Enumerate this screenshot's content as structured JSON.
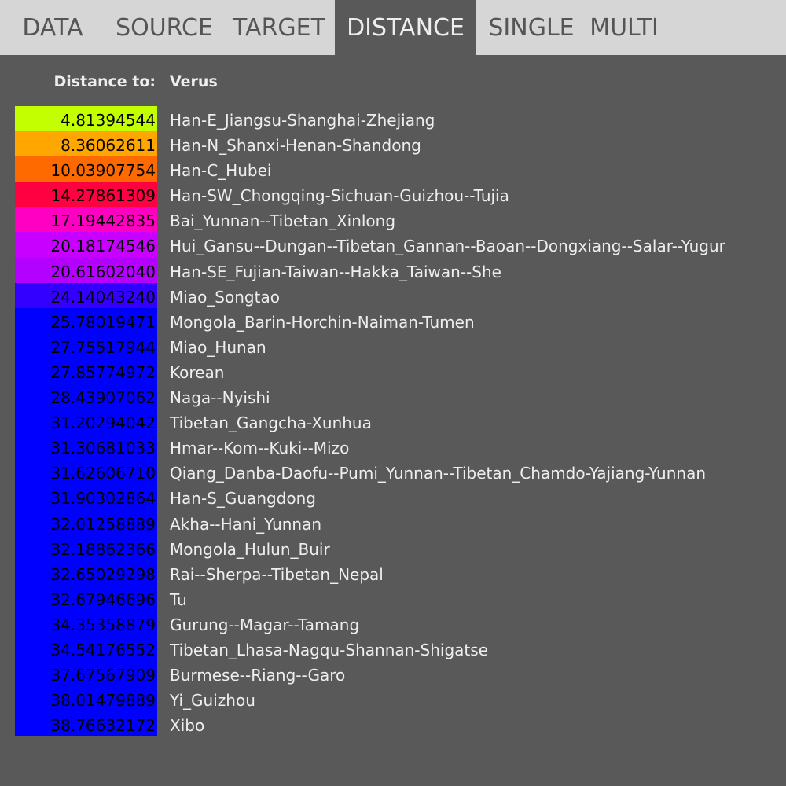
{
  "tabs": [
    {
      "label": "DATA",
      "active": false,
      "width": 134
    },
    {
      "label": "SOURCE",
      "active": false,
      "width": 150
    },
    {
      "label": "TARGET",
      "active": false,
      "width": 142
    },
    {
      "label": "DISTANCE",
      "active": true,
      "width": 180
    },
    {
      "label": "SINGLE",
      "active": false,
      "width": 140
    },
    {
      "label": "MULTI",
      "active": false,
      "width": 96
    }
  ],
  "header": {
    "distance_label": "Distance to:",
    "target_name": "Verus"
  },
  "results": [
    {
      "distance": "4.81394544",
      "name": "Han-E_Jiangsu-Shanghai-Zhejiang",
      "color": "#c3ff00"
    },
    {
      "distance": "8.36062611",
      "name": "Han-N_Shanxi-Henan-Shandong",
      "color": "#ffa700"
    },
    {
      "distance": "10.03907754",
      "name": "Han-C_Hubei",
      "color": "#ff6a00"
    },
    {
      "distance": "14.27861309",
      "name": "Han-SW_Chongqing-Sichuan-Guizhou--Tujia",
      "color": "#ff0040"
    },
    {
      "distance": "17.19442835",
      "name": "Bai_Yunnan--Tibetan_Xinlong",
      "color": "#ff00c3"
    },
    {
      "distance": "20.18174546",
      "name": "Hui_Gansu--Dungan--Tibetan_Gannan--Baoan--Dongxiang--Salar--Yugur",
      "color": "#c800ff"
    },
    {
      "distance": "20.61602040",
      "name": "Han-SE_Fujian-Taiwan--Hakka_Taiwan--She",
      "color": "#b400ff"
    },
    {
      "distance": "24.14043240",
      "name": "Miao_Songtao",
      "color": "#3300ff"
    },
    {
      "distance": "25.78019471",
      "name": "Mongola_Barin-Horchin-Naiman-Tumen",
      "color": "#0000ff"
    },
    {
      "distance": "27.75517944",
      "name": "Miao_Hunan",
      "color": "#0000ff"
    },
    {
      "distance": "27.85774972",
      "name": "Korean",
      "color": "#0000ff"
    },
    {
      "distance": "28.43907062",
      "name": "Naga--Nyishi",
      "color": "#0000ff"
    },
    {
      "distance": "31.20294042",
      "name": "Tibetan_Gangcha-Xunhua",
      "color": "#0000ff"
    },
    {
      "distance": "31.30681033",
      "name": "Hmar--Kom--Kuki--Mizo",
      "color": "#0000ff"
    },
    {
      "distance": "31.62606710",
      "name": "Qiang_Danba-Daofu--Pumi_Yunnan--Tibetan_Chamdo-Yajiang-Yunnan",
      "color": "#0000ff"
    },
    {
      "distance": "31.90302864",
      "name": "Han-S_Guangdong",
      "color": "#0000ff"
    },
    {
      "distance": "32.01258889",
      "name": "Akha--Hani_Yunnan",
      "color": "#0000ff"
    },
    {
      "distance": "32.18862366",
      "name": "Mongola_Hulun_Buir",
      "color": "#0000ff"
    },
    {
      "distance": "32.65029298",
      "name": "Rai--Sherpa--Tibetan_Nepal",
      "color": "#0000ff"
    },
    {
      "distance": "32.67946696",
      "name": "Tu",
      "color": "#0000ff"
    },
    {
      "distance": "34.35358879",
      "name": "Gurung--Magar--Tamang",
      "color": "#0000ff"
    },
    {
      "distance": "34.54176552",
      "name": "Tibetan_Lhasa-Nagqu-Shannan-Shigatse",
      "color": "#0000ff"
    },
    {
      "distance": "37.67567909",
      "name": "Burmese--Riang--Garo",
      "color": "#0000ff"
    },
    {
      "distance": "38.01479889",
      "name": "Yi_Guizhou",
      "color": "#0000ff"
    },
    {
      "distance": "38.76632172",
      "name": "Xibo",
      "color": "#0000ff"
    }
  ]
}
